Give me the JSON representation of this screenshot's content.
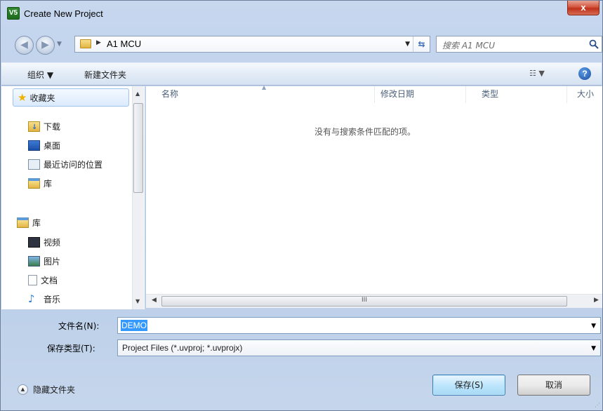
{
  "window": {
    "title": "Create New Project",
    "app_icon_text": "V5",
    "close_label": "x"
  },
  "address": {
    "path_segment": "A1 MCU",
    "search_placeholder": "搜索 A1 MCU"
  },
  "toolbar": {
    "organize_label": "组织 ▼",
    "new_folder_label": "新建文件夹",
    "view_label": "☷ ▼",
    "help_label": "?"
  },
  "nav": {
    "favorites_label": "收藏夹",
    "items": [
      {
        "label": "下载",
        "icon": "download-folder-icon"
      },
      {
        "label": "桌面",
        "icon": "desktop-icon"
      },
      {
        "label": "最近访问的位置",
        "icon": "recent-places-icon"
      },
      {
        "label": "库",
        "icon": "library-icon"
      }
    ],
    "library_label": "库",
    "library_items": [
      {
        "label": "视频",
        "icon": "video-icon"
      },
      {
        "label": "图片",
        "icon": "pictures-icon"
      },
      {
        "label": "文档",
        "icon": "documents-icon"
      },
      {
        "label": "音乐",
        "icon": "music-icon"
      }
    ]
  },
  "content": {
    "columns": [
      "名称",
      "修改日期",
      "类型",
      "大小"
    ],
    "empty_message": "没有与搜索条件匹配的项。",
    "hscroll_grip": "III"
  },
  "form": {
    "filename_label": "文件名(N):",
    "filename_value": "DEMO",
    "filetype_label": "保存类型(T):",
    "filetype_value": "Project Files (*.uvproj; *.uvprojx)"
  },
  "footer": {
    "hide_folders_label": "隐藏文件夹",
    "save_label": "保存(S)",
    "cancel_label": "取消"
  }
}
